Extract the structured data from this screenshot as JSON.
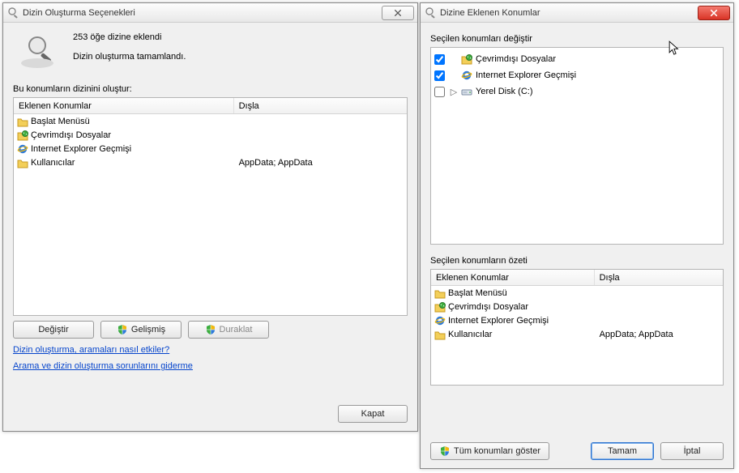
{
  "dlg1": {
    "title": "Dizin Oluşturma Seçenekleri",
    "status_line1": "253 öğe dizine eklendi",
    "status_line2": "Dizin oluşturma tamamlandı.",
    "section_label": "Bu konumların dizinini oluştur:",
    "col1": "Eklenen Konumlar",
    "col2": "Dışla",
    "rows": [
      {
        "icon": "folder",
        "name": "Başlat Menüsü",
        "exclude": ""
      },
      {
        "icon": "offline",
        "name": "Çevrimdışı Dosyalar",
        "exclude": ""
      },
      {
        "icon": "ie",
        "name": "Internet Explorer Geçmişi",
        "exclude": ""
      },
      {
        "icon": "folder",
        "name": "Kullanıcılar",
        "exclude": "AppData; AppData"
      }
    ],
    "btn_change": "Değiştir",
    "btn_advanced": "Gelişmiş",
    "btn_pause": "Duraklat",
    "link_how": "Dizin oluşturma, aramaları nasıl etkiler?",
    "link_troubleshoot": "Arama ve dizin oluşturma sorunlarını giderme",
    "btn_close": "Kapat"
  },
  "dlg2": {
    "title": "Dizine Eklenen Konumlar",
    "top_label": "Seçilen konumları değiştir",
    "tree": [
      {
        "checked": true,
        "icon": "offline",
        "name": "Çevrimdışı Dosyalar",
        "selected": true,
        "expander": ""
      },
      {
        "checked": true,
        "icon": "ie",
        "name": "Internet Explorer Geçmişi",
        "selected": false,
        "expander": ""
      },
      {
        "checked": false,
        "icon": "drive",
        "name": "Yerel Disk (C:)",
        "selected": false,
        "expander": "▷"
      }
    ],
    "summary_label": "Seçilen konumların özeti",
    "col1": "Eklenen Konumlar",
    "col2": "Dışla",
    "rows": [
      {
        "icon": "folder",
        "name": "Başlat Menüsü",
        "exclude": ""
      },
      {
        "icon": "offline",
        "name": "Çevrimdışı Dosyalar",
        "exclude": ""
      },
      {
        "icon": "ie",
        "name": "Internet Explorer Geçmişi",
        "exclude": ""
      },
      {
        "icon": "folder",
        "name": "Kullanıcılar",
        "exclude": "AppData; AppData"
      }
    ],
    "btn_showall": "Tüm konumları göster",
    "btn_ok": "Tamam",
    "btn_cancel": "İptal"
  }
}
